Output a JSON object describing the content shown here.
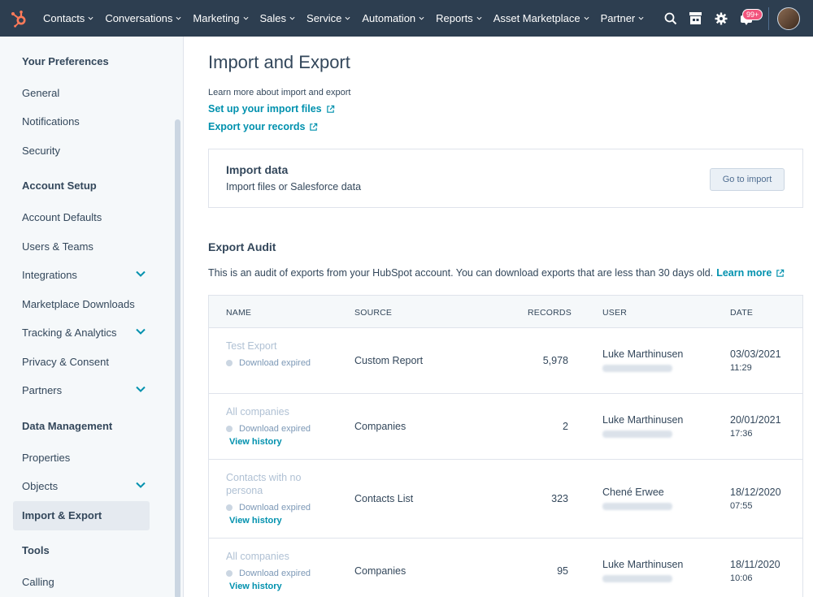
{
  "topnav": {
    "items": [
      {
        "label": "Contacts"
      },
      {
        "label": "Conversations"
      },
      {
        "label": "Marketing"
      },
      {
        "label": "Sales"
      },
      {
        "label": "Service"
      },
      {
        "label": "Automation"
      },
      {
        "label": "Reports"
      },
      {
        "label": "Asset Marketplace"
      },
      {
        "label": "Partner"
      }
    ],
    "notifications_badge": "99+"
  },
  "sidebar": {
    "sections": [
      {
        "heading": "Your Preferences",
        "items": [
          "General",
          "Notifications",
          "Security"
        ]
      },
      {
        "heading": "Account Setup",
        "items": [
          "Account Defaults",
          "Users & Teams",
          "Integrations",
          "Marketplace Downloads",
          "Tracking & Analytics",
          "Privacy & Consent",
          "Partners"
        ]
      },
      {
        "heading": "Data Management",
        "items": [
          "Properties",
          "Objects",
          "Import & Export"
        ]
      },
      {
        "heading": "Tools",
        "items": [
          "Calling"
        ]
      }
    ],
    "active_item": "Import & Export"
  },
  "main": {
    "title": "Import and Export",
    "learn_label": "Learn more about import and export",
    "link_import": "Set up your import files",
    "link_export": "Export your records",
    "import_box": {
      "title": "Import data",
      "subtitle": "Import files or Salesforce data",
      "button": "Go to import"
    },
    "audit": {
      "title": "Export Audit",
      "description": "This is an audit of exports from your HubSpot account. You can download exports that are less than 30 days old.",
      "learn_more": "Learn more",
      "columns": [
        "NAME",
        "SOURCE",
        "RECORDS",
        "USER",
        "DATE"
      ],
      "rows": [
        {
          "name": "Test Export",
          "status": "Download expired",
          "history": "",
          "source": "Custom Report",
          "records": "5,978",
          "user": "Luke Marthinusen",
          "date": "03/03/2021",
          "time": "11:29"
        },
        {
          "name": "All companies",
          "status": "Download expired",
          "history": "View history",
          "source": "Companies",
          "records": "2",
          "user": "Luke Marthinusen",
          "date": "20/01/2021",
          "time": "17:36"
        },
        {
          "name": "Contacts with no persona",
          "status": "Download expired",
          "history": "View history",
          "source": "Contacts List",
          "records": "323",
          "user": "Chené Erwee",
          "date": "18/12/2020",
          "time": "07:55"
        },
        {
          "name": "All companies",
          "status": "Download expired",
          "history": "View history",
          "source": "Companies",
          "records": "95",
          "user": "Luke Marthinusen",
          "date": "18/11/2020",
          "time": "10:06"
        }
      ]
    }
  },
  "colors": {
    "nav_bg": "#2d3e50",
    "link": "#0091ae",
    "logo": "#ff7a59",
    "badge": "#f2547d"
  }
}
